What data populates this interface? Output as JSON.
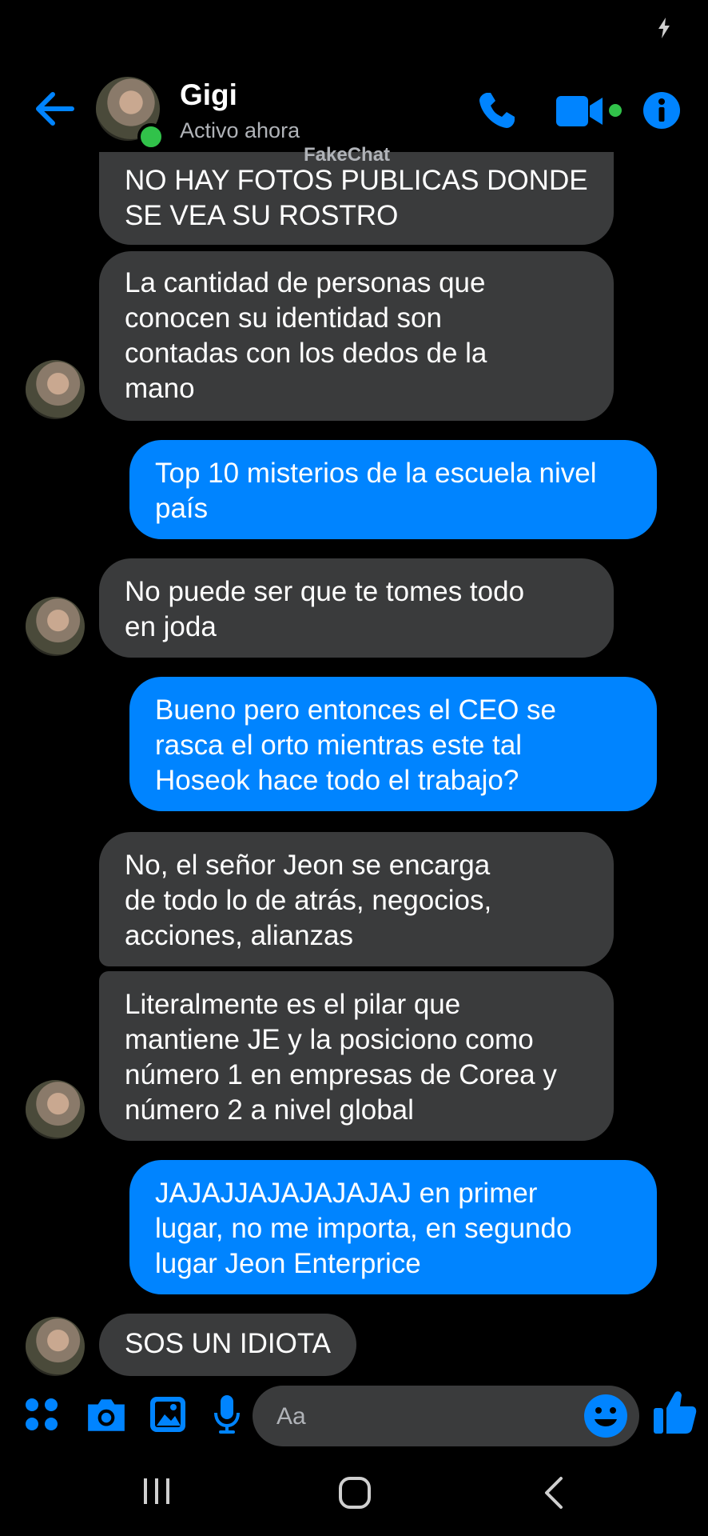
{
  "header": {
    "name": "Gigi",
    "status": "Activo ahora",
    "watermark": "FakeChat"
  },
  "messages": [
    {
      "from": "contact",
      "lines": [
        "NO HAY FOTOS PUBLICAS DONDE",
        "SE VEA SU ROSTRO"
      ]
    },
    {
      "from": "contact",
      "lines": [
        "La cantidad de personas que",
        "conocen su identidad son",
        "contadas con los dedos de la",
        "mano"
      ]
    },
    {
      "from": "me",
      "lines": [
        "Top 10 misterios de la escuela nivel",
        "país"
      ]
    },
    {
      "from": "contact",
      "lines": [
        "No puede ser que te tomes todo",
        "en joda"
      ]
    },
    {
      "from": "me",
      "lines": [
        "Bueno pero entonces el CEO se",
        "rasca el orto mientras este tal",
        "Hoseok hace todo el trabajo?"
      ]
    },
    {
      "from": "contact",
      "lines": [
        "No, el señor Jeon se encarga",
        "de todo lo de atrás, negocios,",
        "acciones, alianzas"
      ]
    },
    {
      "from": "contact",
      "lines": [
        "Literalmente es el pilar que",
        "mantiene JE y la posiciono como",
        "número 1 en empresas de Corea y",
        "número 2 a nivel global"
      ]
    },
    {
      "from": "me",
      "lines": [
        "JAJAJJAJAJAJAJAJ en primer",
        "lugar, no me importa, en segundo",
        "lugar Jeon Enterprice"
      ]
    },
    {
      "from": "contact",
      "lines": [
        "SOS UN IDIOTA"
      ]
    }
  ],
  "composer": {
    "placeholder": "Aa"
  },
  "icons": {
    "accent": "#0084ff",
    "online": "#31c24a",
    "incoming_bubble": "#3a3b3c",
    "outgoing_bubble": "#0084ff"
  }
}
